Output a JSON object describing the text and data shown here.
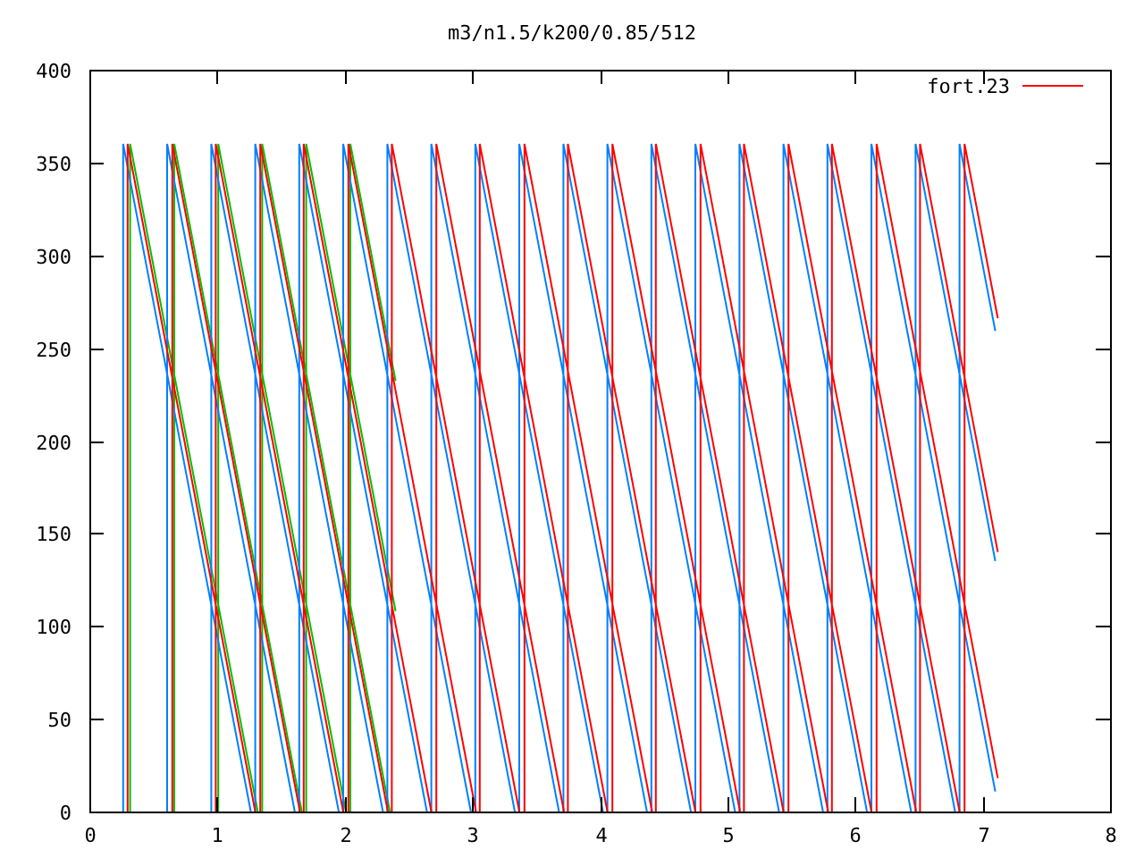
{
  "chart_data": {
    "type": "line",
    "title": "m3/n1.5/k200/0.85/512",
    "xlim": [
      0,
      8
    ],
    "ylim": [
      0,
      400
    ],
    "xticks": [
      0,
      1,
      2,
      3,
      4,
      5,
      6,
      7,
      8
    ],
    "yticks": [
      0,
      50,
      100,
      150,
      200,
      250,
      300,
      350,
      400
    ],
    "series": [
      {
        "name": "fort.23",
        "color": "#ff0000",
        "x": [
          0.3,
          0.3,
          1.3,
          0.65,
          0.65,
          1.65,
          0.99,
          0.99,
          1.99,
          1.34,
          1.34,
          2.34,
          1.68,
          1.68,
          2.68,
          2.03,
          2.03,
          3.03,
          2.37,
          2.37,
          3.37,
          2.72,
          2.72,
          3.72,
          3.06,
          3.06,
          4.06,
          3.41,
          3.41,
          4.41,
          3.75,
          3.75,
          4.75,
          4.1,
          4.1,
          5.1,
          4.44,
          4.44,
          5.44,
          4.79,
          4.79,
          5.79,
          5.13,
          5.13,
          6.13,
          5.48,
          5.48,
          6.48,
          5.82,
          5.82,
          6.82,
          6.17,
          6.17,
          7.12,
          6.51,
          6.51,
          7.12,
          6.86,
          6.86,
          7.12
        ],
        "values": [
          0,
          360,
          0,
          0,
          360,
          0,
          0,
          360,
          0,
          0,
          360,
          0,
          0,
          360,
          0,
          0,
          360,
          0,
          0,
          360,
          0,
          0,
          360,
          0,
          0,
          360,
          0,
          0,
          360,
          0,
          0,
          360,
          0,
          0,
          360,
          0,
          0,
          360,
          0,
          0,
          360,
          0,
          0,
          360,
          0,
          0,
          360,
          0,
          0,
          360,
          0,
          0,
          360,
          18,
          0,
          360,
          140,
          0,
          360,
          266
        ]
      }
    ]
  }
}
